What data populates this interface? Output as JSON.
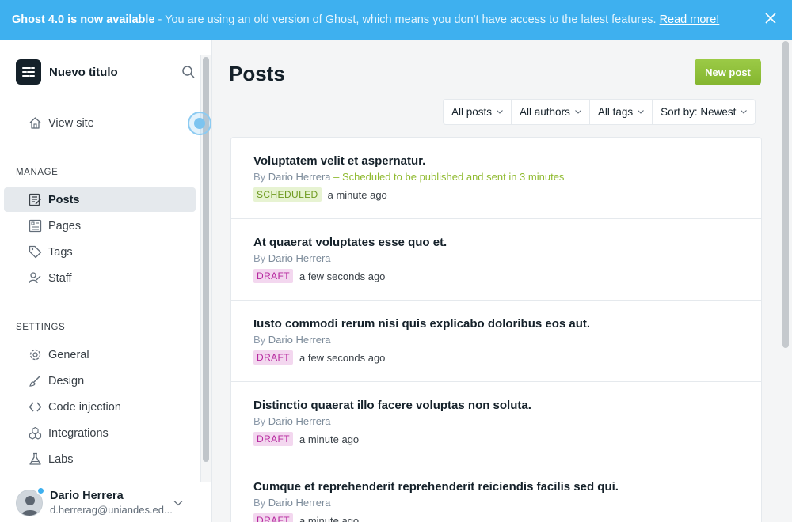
{
  "banner": {
    "strong": "Ghost 4.0 is now available",
    "text": "- You are using an old version of Ghost, which means you don't have access to the latest features.",
    "link": "Read more!"
  },
  "sidebar": {
    "site_title": "Nuevo titulo",
    "view_site": "View site",
    "manage_title": "MANAGE",
    "manage_items": [
      {
        "label": "Posts",
        "icon": "posts-icon",
        "active": true
      },
      {
        "label": "Pages",
        "icon": "pages-icon"
      },
      {
        "label": "Tags",
        "icon": "tag-icon"
      },
      {
        "label": "Staff",
        "icon": "staff-icon"
      }
    ],
    "settings_title": "SETTINGS",
    "settings_items": [
      {
        "label": "General",
        "icon": "gear-icon"
      },
      {
        "label": "Design",
        "icon": "brush-icon"
      },
      {
        "label": "Code injection",
        "icon": "code-icon"
      },
      {
        "label": "Integrations",
        "icon": "integrations-icon"
      },
      {
        "label": "Labs",
        "icon": "flask-icon"
      }
    ],
    "user": {
      "name": "Dario Herrera",
      "email": "d.herrerag@uniandes.ed..."
    }
  },
  "main": {
    "title": "Posts",
    "new_post": "New post",
    "filters": [
      "All posts",
      "All authors",
      "All tags",
      "Sort by: Newest"
    ],
    "posts": [
      {
        "title": "Voluptatem velit et aspernatur.",
        "by": "By",
        "author": "Dario Herrera",
        "note": " – Scheduled to be published and sent in 3 minutes",
        "status": "SCHEDULED",
        "time": "a minute ago"
      },
      {
        "title": "At quaerat voluptates esse quo et.",
        "by": "By",
        "author": "Dario Herrera",
        "note": "",
        "status": "DRAFT",
        "time": "a few seconds ago"
      },
      {
        "title": "Iusto commodi rerum nisi quis explicabo doloribus eos aut.",
        "by": "By",
        "author": "Dario Herrera",
        "note": "",
        "status": "DRAFT",
        "time": "a few seconds ago"
      },
      {
        "title": "Distinctio quaerat illo facere voluptas non soluta.",
        "by": "By",
        "author": "Dario Herrera",
        "note": "",
        "status": "DRAFT",
        "time": "a minute ago"
      },
      {
        "title": "Cumque et reprehenderit reprehenderit reiciendis facilis sed qui.",
        "by": "By",
        "author": "Dario Herrera",
        "note": "",
        "status": "DRAFT",
        "time": "a minute ago"
      }
    ]
  },
  "colors": {
    "banner": "#3eb0ef",
    "accent_green": "#8cbd38",
    "draft_badge": "#f3d7ef",
    "scheduled_badge": "#e7f3d2"
  }
}
